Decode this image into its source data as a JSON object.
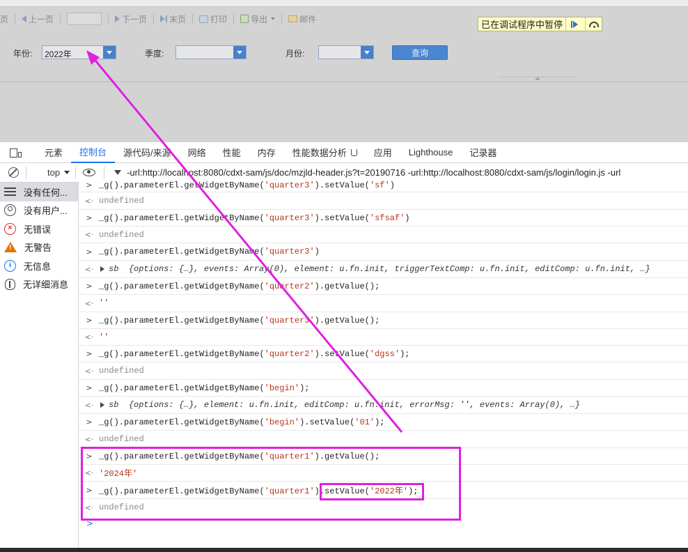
{
  "report_toolbar": {
    "first_page": "首页",
    "prev_page": "上一页",
    "next_page": "下一页",
    "last_page": "末页",
    "print": "打印",
    "export": "导出",
    "mail": "邮件"
  },
  "debug_banner": {
    "text": "已在调试程序中暂停"
  },
  "filters": {
    "year_label": "年份:",
    "year_value": "2022年",
    "quarter_label": "季度:",
    "quarter_value": "",
    "month_label": "月份:",
    "month_value": "",
    "query_button": "查询"
  },
  "devtools_tabs": [
    {
      "label": "元素",
      "active": false
    },
    {
      "label": "控制台",
      "active": true
    },
    {
      "label": "源代码/来源",
      "active": false
    },
    {
      "label": "网络",
      "active": false
    },
    {
      "label": "性能",
      "active": false
    },
    {
      "label": "内存",
      "active": false
    },
    {
      "label": "性能数据分析",
      "active": false
    },
    {
      "label": "应用",
      "active": false
    },
    {
      "label": "Lighthouse",
      "active": false
    },
    {
      "label": "记录器",
      "active": false
    }
  ],
  "console_toolbar": {
    "context": "top",
    "filter_text": "-url:http://localhost:8080/cdxt-sam/js/doc/mzjld-header.js?t=20190716 -url:http://localhost:8080/cdxt-sam/js/login/login.js -url"
  },
  "sidebar": [
    {
      "label": "没有任何...",
      "icon": "list-icon"
    },
    {
      "label": "没有用户...",
      "icon": "user-icon"
    },
    {
      "label": "无错误",
      "icon": "error-icon"
    },
    {
      "label": "无警告",
      "icon": "warning-icon"
    },
    {
      "label": "无信息",
      "icon": "info-icon"
    },
    {
      "label": "无详细消息",
      "icon": "bug-icon"
    }
  ],
  "console": {
    "r0": {
      "pre": "_g().parameterEl.getWidgetByName(",
      "s1": "'quarter3'",
      "mid": ").setValue(",
      "s2": "'sf'",
      "post": ")"
    },
    "r1": "undefined",
    "r2": {
      "pre": "_g().parameterEl.getWidgetByName(",
      "s1": "'quarter3'",
      "mid": ").setValue(",
      "s2": "'sfsaf'",
      "post": ")"
    },
    "r3": "undefined",
    "r4": {
      "pre": "_g().parameterEl.getWidgetByName(",
      "s1": "'quarter3'",
      "post": ")"
    },
    "r5": {
      "name": "sb",
      "body": "{options: {…}, events: Array(0), element: u.fn.init, triggerTextComp: u.fn.init, editComp: u.fn.init, …}"
    },
    "r6": {
      "pre": " _g().parameterEl.getWidgetByName(",
      "s1": "'quarter2'",
      "post": ").getValue();"
    },
    "r7": "''",
    "r8": {
      "pre": " _g().parameterEl.getWidgetByName(",
      "s1": "'quarter3'",
      "post": ").getValue();"
    },
    "r9": "''",
    "r10": {
      "pre": " _g().parameterEl.getWidgetByName(",
      "s1": "'quarter2'",
      "mid": ").setValue(",
      "s2": "'dgss'",
      "post": ");"
    },
    "r11": "undefined",
    "r12": {
      "pre": "_g().parameterEl.getWidgetByName(",
      "s1": "'begin'",
      "post": ");"
    },
    "r13": {
      "name": "sb",
      "body": "{options: {…}, element: u.fn.init, editComp: u.fn.init, errorMsg: '', events: Array(0), …}"
    },
    "r14": {
      "pre": "_g().parameterEl.getWidgetByName(",
      "s1": "'begin'",
      "mid": ").setValue(",
      "s2": "'01'",
      "post": ");"
    },
    "r15": "undefined",
    "r16": {
      "pre": " _g().parameterEl.getWidgetByName(",
      "s1": "'quarter1'",
      "post": ").getValue();"
    },
    "r17": "'2024年'",
    "r18": {
      "pre": " _g().parameterEl.getWidgetByName(",
      "s1": "'quarter1'",
      "mid": ").setValue(",
      "s2": "'2022年'",
      "post": ");"
    },
    "r19": "undefined"
  },
  "colors": {
    "annotation": "#e020e0",
    "active_tab": "#1a73e8",
    "string": "#b5341a"
  }
}
